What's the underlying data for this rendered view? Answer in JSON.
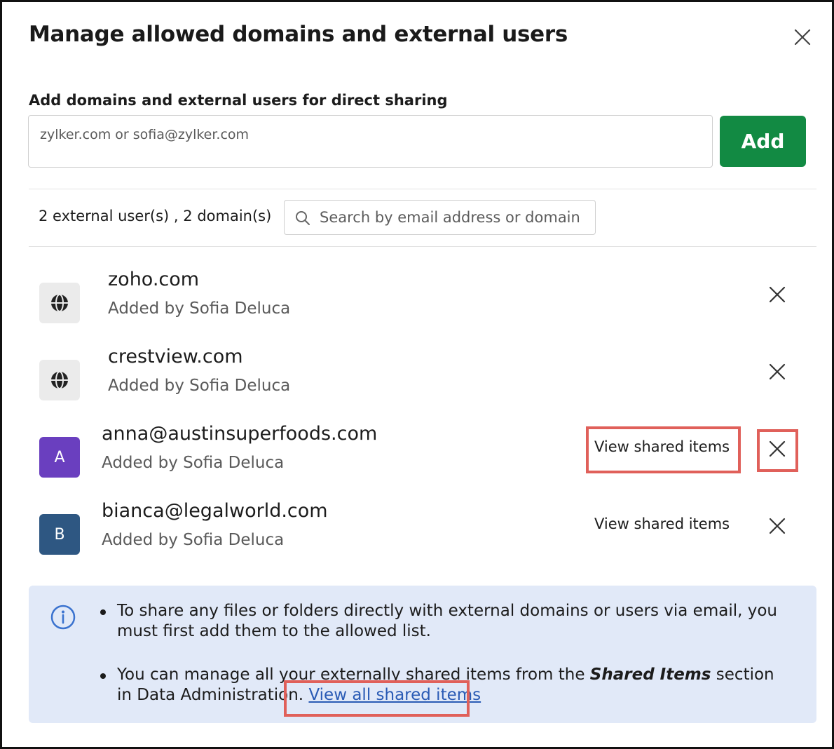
{
  "dialog": {
    "title": "Manage allowed domains and external users"
  },
  "add_section": {
    "label": "Add domains and external users for direct sharing",
    "input_placeholder": "zylker.com or sofia@zylker.com",
    "input_value": "",
    "button_label": "Add"
  },
  "list_header": {
    "count_text": "2 external user(s) , 2 domain(s)",
    "search_placeholder": "Search by email address or domain"
  },
  "entries": [
    {
      "type": "domain",
      "name": "zoho.com",
      "added_by": "Added by Sofia Deluca",
      "icon": "globe-icon"
    },
    {
      "type": "domain",
      "name": "crestview.com",
      "added_by": "Added by Sofia Deluca",
      "icon": "globe-icon"
    },
    {
      "type": "user",
      "name": "anna@austinsuperfoods.com",
      "added_by": "Added by Sofia Deluca",
      "initial": "A",
      "avatar_color": "#6a3fbf",
      "view_label": "View shared items"
    },
    {
      "type": "user",
      "name": "bianca@legalworld.com",
      "added_by": "Added by Sofia Deluca",
      "initial": "B",
      "avatar_color": "#2e5782",
      "view_label": "View shared items"
    }
  ],
  "info": {
    "bullet1": "To share any files or folders directly with external domains or users via email, you must first add them to the allowed list.",
    "bullet2_prefix": "You can manage all your externally shared items from the ",
    "bullet2_bold": "Shared Items",
    "bullet2_suffix": " section in Data Administration. ",
    "bullet2_link": "View all shared items"
  },
  "colors": {
    "primary_green": "#128a43",
    "info_background": "#e1e9f8",
    "highlight_red": "#e0605a",
    "link_blue": "#2a5bb5"
  }
}
